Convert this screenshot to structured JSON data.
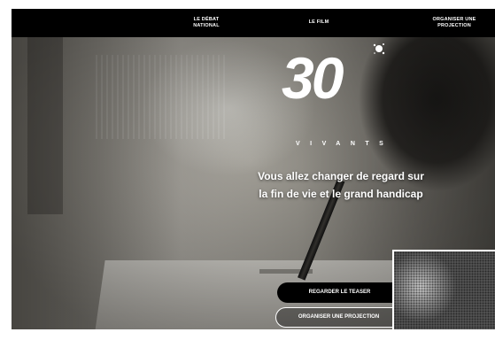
{
  "nav": {
    "items": [
      {
        "line1": "LE DÉBAT",
        "line2": "NATIONAL"
      },
      {
        "line1": "LE FILM",
        "line2": ""
      },
      {
        "line1": "ORGANISER UNE",
        "line2": "PROJECTION"
      }
    ]
  },
  "hero": {
    "logo_number": "30",
    "logo_word": "VIVANTS",
    "headline_line1": "Vous allez changer de regard sur",
    "headline_line2": "la fin de vie et le grand handicap",
    "cta_primary": "REGARDER LE TEASER",
    "cta_secondary": "ORGANISER UNE PROJECTION"
  },
  "colors": {
    "nav_bg": "#000000",
    "text": "#ffffff",
    "button_primary_bg": "#000000"
  }
}
